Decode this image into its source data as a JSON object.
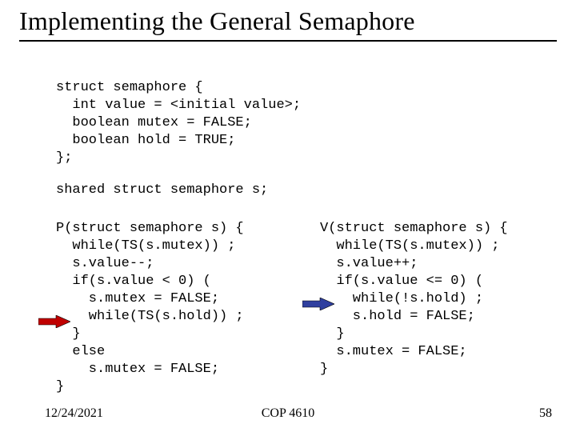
{
  "title": "Implementing the General Semaphore",
  "code": {
    "struct_def": "struct semaphore {\n  int value = <initial value>;\n  boolean mutex = FALSE;\n  boolean hold = TRUE;\n};",
    "shared_decl": "shared struct semaphore s;",
    "p_func": "P(struct semaphore s) {\n  while(TS(s.mutex)) ;\n  s.value--;\n  if(s.value < 0) (\n    s.mutex = FALSE;\n    while(TS(s.hold)) ;\n  }\n  else\n    s.mutex = FALSE;\n}",
    "v_func": "V(struct semaphore s) {\n  while(TS(s.mutex)) ;\n  s.value++;\n  if(s.value <= 0) (\n    while(!s.hold) ;\n    s.hold = FALSE;\n  }\n  s.mutex = FALSE;\n}"
  },
  "arrows": {
    "red": "#c00000",
    "blue": "#2f3f9f"
  },
  "footer": {
    "date": "12/24/2021",
    "course": "COP 4610",
    "page": "58"
  }
}
